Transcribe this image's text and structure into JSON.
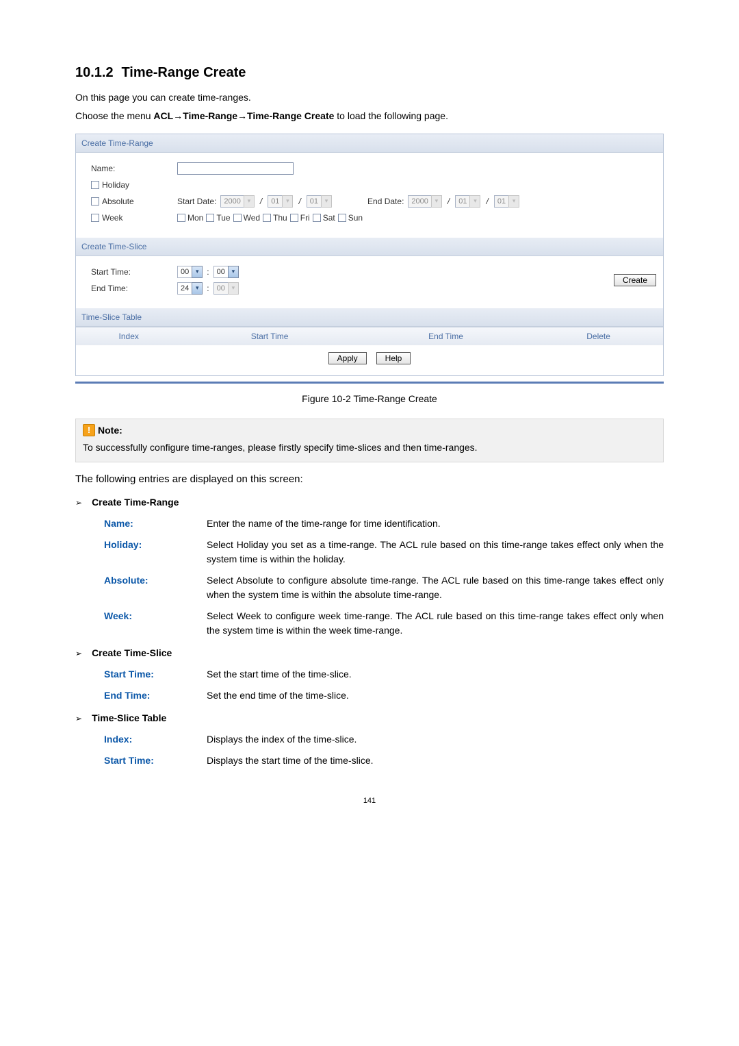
{
  "section": {
    "number": "10.1.2",
    "title": "Time-Range Create"
  },
  "intro": {
    "line1": "On this page you can create time-ranges.",
    "line2_pre": "Choose the menu ",
    "line2_bold": "ACL→Time-Range→Time-Range Create",
    "line2_post": " to load the following page."
  },
  "panel": {
    "ctr": {
      "header": "Create Time-Range",
      "name_label": "Name:",
      "name_value": "",
      "holiday_label": "Holiday",
      "absolute_label": "Absolute",
      "start_date_label": "Start Date:",
      "end_date_label": "End Date:",
      "date_year": "2000",
      "date_mm": "01",
      "date_dd": "01",
      "week_label": "Week",
      "days": {
        "mon": "Mon",
        "tue": "Tue",
        "wed": "Wed",
        "thu": "Thu",
        "fri": "Fri",
        "sat": "Sat",
        "sun": "Sun"
      }
    },
    "cts": {
      "header": "Create Time-Slice",
      "start_label": "Start Time:",
      "end_label": "End Time:",
      "sh": "00",
      "sm": "00",
      "eh": "24",
      "em": "00",
      "create_btn": "Create"
    },
    "tst": {
      "header": "Time-Slice Table",
      "col_index": "Index",
      "col_start": "Start Time",
      "col_end": "End Time",
      "col_delete": "Delete"
    },
    "buttons": {
      "apply": "Apply",
      "help": "Help"
    }
  },
  "figure_caption": "Figure 10-2 Time-Range Create",
  "note": {
    "label": "Note:",
    "text": "To successfully configure time-ranges, please firstly specify time-slices and then time-ranges."
  },
  "follow_text": "The following entries are displayed on this screen:",
  "sections": {
    "s1": {
      "title": "Create Time-Range",
      "items": {
        "name": {
          "term": "Name:",
          "desc": "Enter the name of the time-range for time identification."
        },
        "holiday": {
          "term": "Holiday:",
          "desc": "Select Holiday you set as a time-range. The ACL rule based on this time-range takes effect only when the system time is within the holiday."
        },
        "absolute": {
          "term": "Absolute:",
          "desc": "Select Absolute to configure absolute time-range. The ACL rule based on this time-range takes effect only when the system time is within the absolute time-range."
        },
        "week": {
          "term": "Week:",
          "desc": "Select Week to configure week time-range. The ACL rule based on this time-range takes effect only when the system time is within the week time-range."
        }
      }
    },
    "s2": {
      "title": "Create Time-Slice",
      "items": {
        "start": {
          "term": "Start Time:",
          "desc": "Set the start time of the time-slice."
        },
        "end": {
          "term": "End Time:",
          "desc": "Set the end time of the time-slice."
        }
      }
    },
    "s3": {
      "title": "Time-Slice Table",
      "items": {
        "index": {
          "term": "Index:",
          "desc": "Displays the index of the time-slice."
        },
        "start": {
          "term": "Start Time:",
          "desc": "Displays the start time of the time-slice."
        }
      }
    }
  },
  "page_number": "141"
}
